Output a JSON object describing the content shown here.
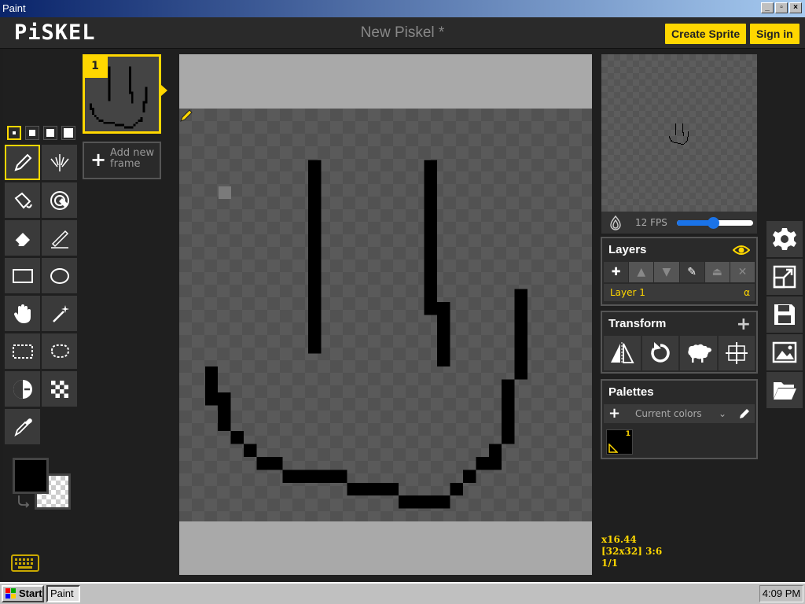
{
  "window": {
    "title": "Paint",
    "minimize": "_",
    "maximize": "▫",
    "close": "×"
  },
  "header": {
    "logo": "PiSKEL",
    "doc_title": "New Piskel *",
    "create_sprite": "Create Sprite",
    "sign_in": "Sign in"
  },
  "frames": {
    "frame_number": "1",
    "add_frame_label": "Add new frame"
  },
  "preview": {
    "fps_label": "12 FPS",
    "fps_value": 12,
    "fps_slider_fraction": 0.47
  },
  "layers": {
    "title": "Layers",
    "layer_name": "Layer 1",
    "alpha_label": "α"
  },
  "transform": {
    "title": "Transform"
  },
  "palettes": {
    "title": "Palettes",
    "current": "Current colors",
    "swatch_index": "1",
    "swatch_color": "#000000"
  },
  "status": {
    "zoom": "x16.44",
    "size": "[32x32] 3:6",
    "frame": "1/1"
  },
  "colors": {
    "primary": "#000000",
    "accent": "#ffd700",
    "slider": "#1a73e8"
  },
  "tools": [
    "pen",
    "vertical-mirror-pen",
    "paint-bucket",
    "paint-same-pixels",
    "eraser",
    "stroke",
    "rectangle",
    "circle",
    "move",
    "shape-selection",
    "rectangle-select",
    "lasso-select",
    "lighten",
    "dithering",
    "color-picker"
  ],
  "taskbar": {
    "start": "Start",
    "task": "Paint",
    "clock": "4:09 PM"
  }
}
